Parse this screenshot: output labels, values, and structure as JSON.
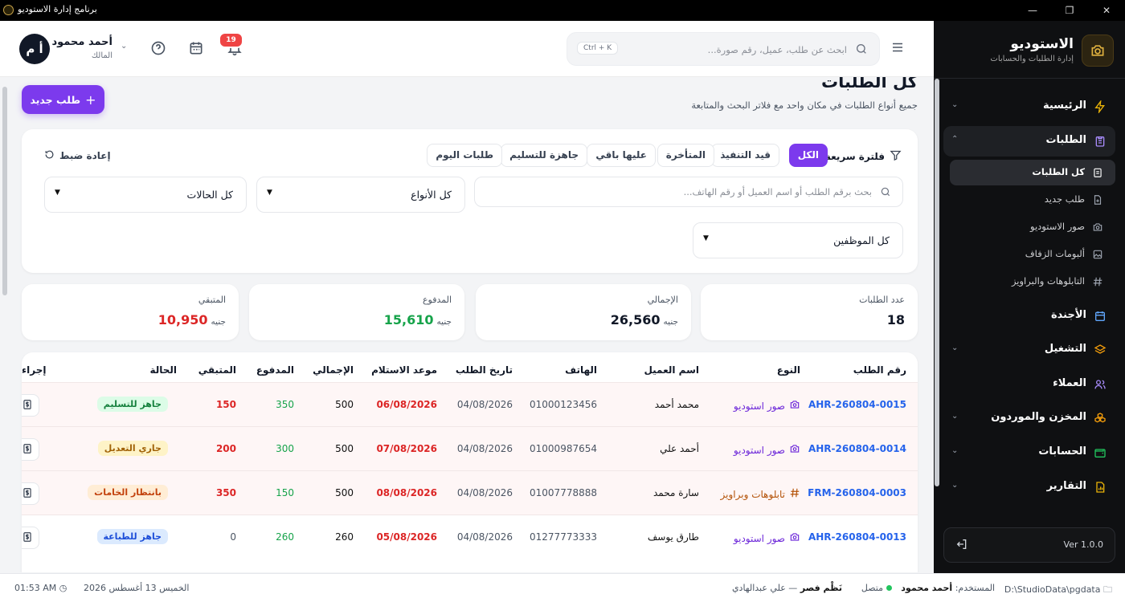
{
  "window": {
    "title": "برنامج إدارة الاستوديو"
  },
  "brand": {
    "title": "الاستوديو",
    "subtitle": "إدارة الطلبات والحسابات"
  },
  "nav": {
    "home": "الرئيسية",
    "orders": "الطلبات",
    "sub": [
      "كل الطلبات",
      "طلب جديد",
      "صور الاستوديو",
      "ألبومات الزفاف",
      "التابلوهات والبراويز"
    ],
    "agenda": "الأجندة",
    "operations": "التشغيل",
    "clients": "العملاء",
    "inventory": "المخزن والموردون",
    "accounts": "الحسابات",
    "reports": "التقارير"
  },
  "version": "Ver 1.0.0",
  "search": {
    "placeholder": "ابحث عن طلب، عميل، رقم صورة...",
    "shortcut": "Ctrl + K"
  },
  "notifications": {
    "count": "19"
  },
  "user": {
    "name": "أحمد محمود",
    "role": "المالك",
    "initials": "أ م"
  },
  "page": {
    "title": "كل الطلبات",
    "subtitle": "جميع أنواع الطلبات في مكان واحد مع فلاتر البحث والمتابعة",
    "new_button": "طلب جديد"
  },
  "filters": {
    "quick_label": "فلترة سريعة",
    "chips": [
      "الكل",
      "قيد التنفيذ",
      "المتأخرة",
      "عليها باقي",
      "جاهزة للتسليم",
      "طلبات اليوم"
    ],
    "reset": "إعادة ضبط",
    "search_placeholder": "بحث برقم الطلب أو اسم العميل أو رقم الهاتف...",
    "types": "كل الأنواع",
    "statuses": "كل الحالات",
    "employees": "كل الموظفين"
  },
  "stats": {
    "count": {
      "label": "عدد الطلبات",
      "value": "18"
    },
    "total": {
      "label": "الإجمالي",
      "value": "26,560",
      "currency": "جنيه"
    },
    "paid": {
      "label": "المدفوع",
      "value": "15,610",
      "currency": "جنيه"
    },
    "remaining": {
      "label": "المتبقي",
      "value": "10,950",
      "currency": "جنيه"
    }
  },
  "table": {
    "headers": [
      "رقم الطلب",
      "النوع",
      "اسم العميل",
      "الهاتف",
      "تاريخ الطلب",
      "موعد الاستلام",
      "الإجمالي",
      "المدفوع",
      "المتبقي",
      "الحالة",
      "إجراء"
    ],
    "rows": [
      {
        "id": "AHR-260804-0015",
        "type": "صور استوديو",
        "name": "محمد أحمد",
        "phone": "01000123456",
        "date": "04/08/2026",
        "due": "06/08/2026",
        "total": "500",
        "paid": "350",
        "remaining": "150",
        "status": "جاهز للتسليم"
      },
      {
        "id": "AHR-260804-0014",
        "type": "صور استوديو",
        "name": "أحمد علي",
        "phone": "01000987654",
        "date": "04/08/2026",
        "due": "07/08/2026",
        "total": "500",
        "paid": "300",
        "remaining": "200",
        "status": "جاري التعديل"
      },
      {
        "id": "FRM-260804-0003",
        "type": "تابلوهات وبراويز",
        "name": "سارة محمد",
        "phone": "01007778888",
        "date": "04/08/2026",
        "due": "08/08/2026",
        "total": "500",
        "paid": "150",
        "remaining": "350",
        "status": "بانتظار الخامات"
      },
      {
        "id": "AHR-260804-0013",
        "type": "صور استوديو",
        "name": "طارق يوسف",
        "phone": "01277773333",
        "date": "04/08/2026",
        "due": "05/08/2026",
        "total": "260",
        "paid": "260",
        "remaining": "0",
        "status": "جاهز للطباعة"
      }
    ]
  },
  "footer": {
    "path": "D:\\StudioData\\pgdata",
    "user_label": "المستخدم:",
    "user_name": "أحمد محمود",
    "connection": "متصل",
    "branch": "نَظْم فصر",
    "branch_sub": "— علي عبدالهادي",
    "date": "الخميس 13 أغسطس 2026",
    "time": "01:53 AM"
  }
}
